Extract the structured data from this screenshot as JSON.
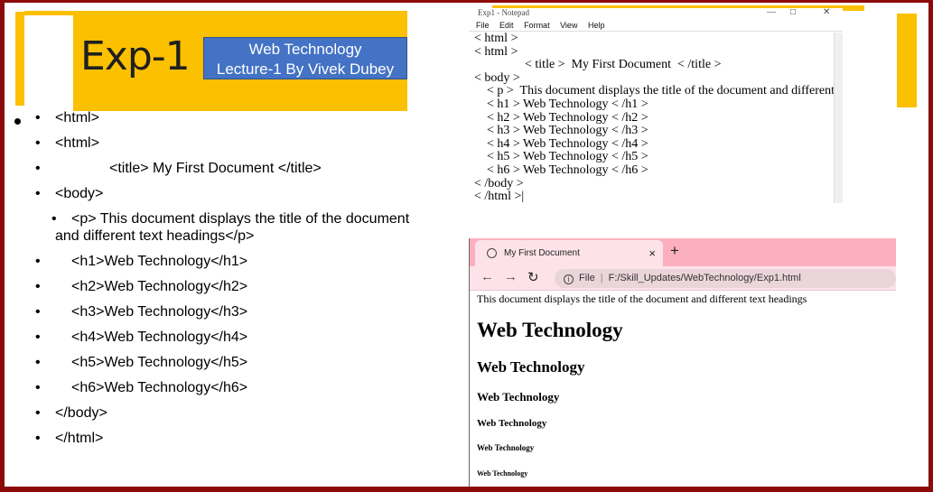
{
  "slide": {
    "title": "Exp-1",
    "subtitle_line1": "Web Technology",
    "subtitle_line2": "Lecture-1 By Vivek Dubey",
    "bullets": [
      "<html>",
      "<html>",
      "            <title> My First Document </title>",
      "<body>",
      "    <p> This document displays the title of the document and different text headings</p>",
      "    <h1>Web Technology</h1>",
      "    <h2>Web Technology</h2>",
      "    <h3>Web Technology</h3>",
      "    <h4>Web Technology</h4>",
      "    <h5>Web Technology</h5>",
      "    <h6>Web Technology</h6>",
      "</body>",
      "</html>"
    ]
  },
  "notepad": {
    "window_title": "Exp1 - Notepad",
    "menu": [
      "File",
      "Edit",
      "Format",
      "View",
      "Help"
    ],
    "lines": [
      "< html >",
      "< html >",
      "                < title >  My First Document  < /title >",
      "< body >",
      "    < p >  This document displays the title of the document and different text headings < /p >",
      "    < h1 > Web Technology < /h1 >",
      "    < h2 > Web Technology < /h2 >",
      "    < h3 > Web Technology < /h3 >",
      "    < h4 > Web Technology < /h4 >",
      "    < h5 > Web Technology < /h5 >",
      "    < h6 > Web Technology < /h6 >",
      "< /body >",
      "< /html >|"
    ]
  },
  "browser": {
    "tab_title": "My First Document",
    "tab_close": "×",
    "new_tab": "+",
    "url_label": "File",
    "url": "F:/Skill_Updates/WebTechnology/Exp1.html",
    "paragraph": "This document displays the title of the document and different text headings",
    "headings": [
      "Web Technology",
      "Web Technology",
      "Web Technology",
      "Web Technology",
      "Web Technology",
      "Web Technology"
    ]
  },
  "colors": {
    "border": "#8b0a0a",
    "accent_gold": "#fbc000",
    "subtitle_blue": "#4472c4",
    "browser_tab_pink": "#fcb0bf"
  }
}
